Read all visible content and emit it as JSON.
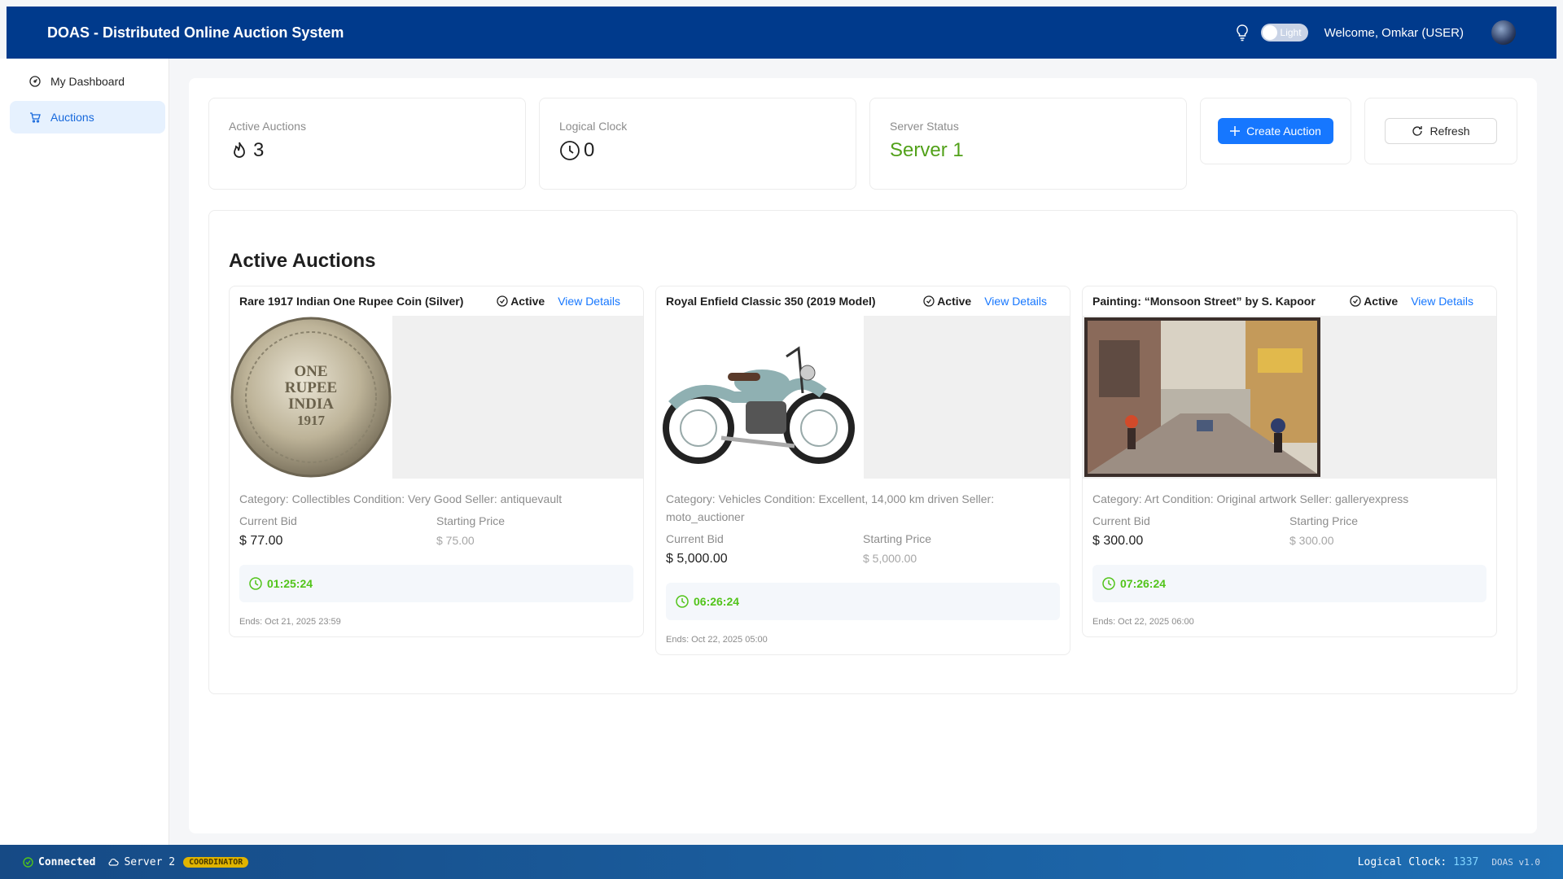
{
  "header": {
    "title": "DOAS - Distributed Online Auction System",
    "theme_label": "Light",
    "welcome": "Welcome, Omkar (USER)"
  },
  "sidebar": {
    "items": [
      {
        "label": "My Dashboard",
        "icon": "dashboard-icon"
      },
      {
        "label": "Auctions",
        "icon": "cart-icon"
      }
    ]
  },
  "stats": {
    "active_auctions": {
      "label": "Active Auctions",
      "value": "3",
      "icon": "fire-icon"
    },
    "logical_clock": {
      "label": "Logical Clock",
      "value": "0",
      "icon": "clock-icon"
    },
    "server_status": {
      "label": "Server Status",
      "value": "Server 1",
      "color": "#52a11a"
    }
  },
  "actions": {
    "create": "Create Auction",
    "refresh": "Refresh"
  },
  "section_title": "Active Auctions",
  "auctions": [
    {
      "name": "Rare 1917 Indian One Rupee Coin (Silver)",
      "status": "Active",
      "view": "View Details",
      "description": "Category: Collectibles Condition: Very Good Seller: antiquevault",
      "current_bid_label": "Current Bid",
      "current_bid": "$ 77.00",
      "starting_label": "Starting Price",
      "starting_price": "$ 75.00",
      "timer": "01:25:24",
      "ends": "Ends: Oct 21, 2025 23:59",
      "coin_text": [
        "ONE",
        "RUPEE",
        "INDIA",
        "1917"
      ]
    },
    {
      "name": "Royal Enfield Classic 350 (2019 Model)",
      "status": "Active",
      "view": "View Details",
      "description": "Category: Vehicles Condition: Excellent, 14,000 km driven Seller: moto_auctioner",
      "current_bid_label": "Current Bid",
      "current_bid": "$ 5,000.00",
      "starting_label": "Starting Price",
      "starting_price": "$ 5,000.00",
      "timer": "06:26:24",
      "ends": "Ends: Oct 22, 2025 05:00"
    },
    {
      "name": "Painting: “Monsoon Street” by S. Kapoor",
      "status": "Active",
      "view": "View Details",
      "description": "Category: Art Condition: Original artwork Seller: galleryexpress",
      "current_bid_label": "Current Bid",
      "current_bid": "$ 300.00",
      "starting_label": "Starting Price",
      "starting_price": "$ 300.00",
      "timer": "07:26:24",
      "ends": "Ends: Oct 22, 2025 06:00"
    }
  ],
  "footer": {
    "connected": "Connected",
    "server": "Server 2",
    "role": "COORDINATOR",
    "clock_label": "Logical Clock:",
    "clock_value": "1337",
    "version": "DOAS v1.0"
  },
  "colors": {
    "header": "#003a8c",
    "primary": "#1677ff",
    "timer_green": "#52c41a"
  }
}
